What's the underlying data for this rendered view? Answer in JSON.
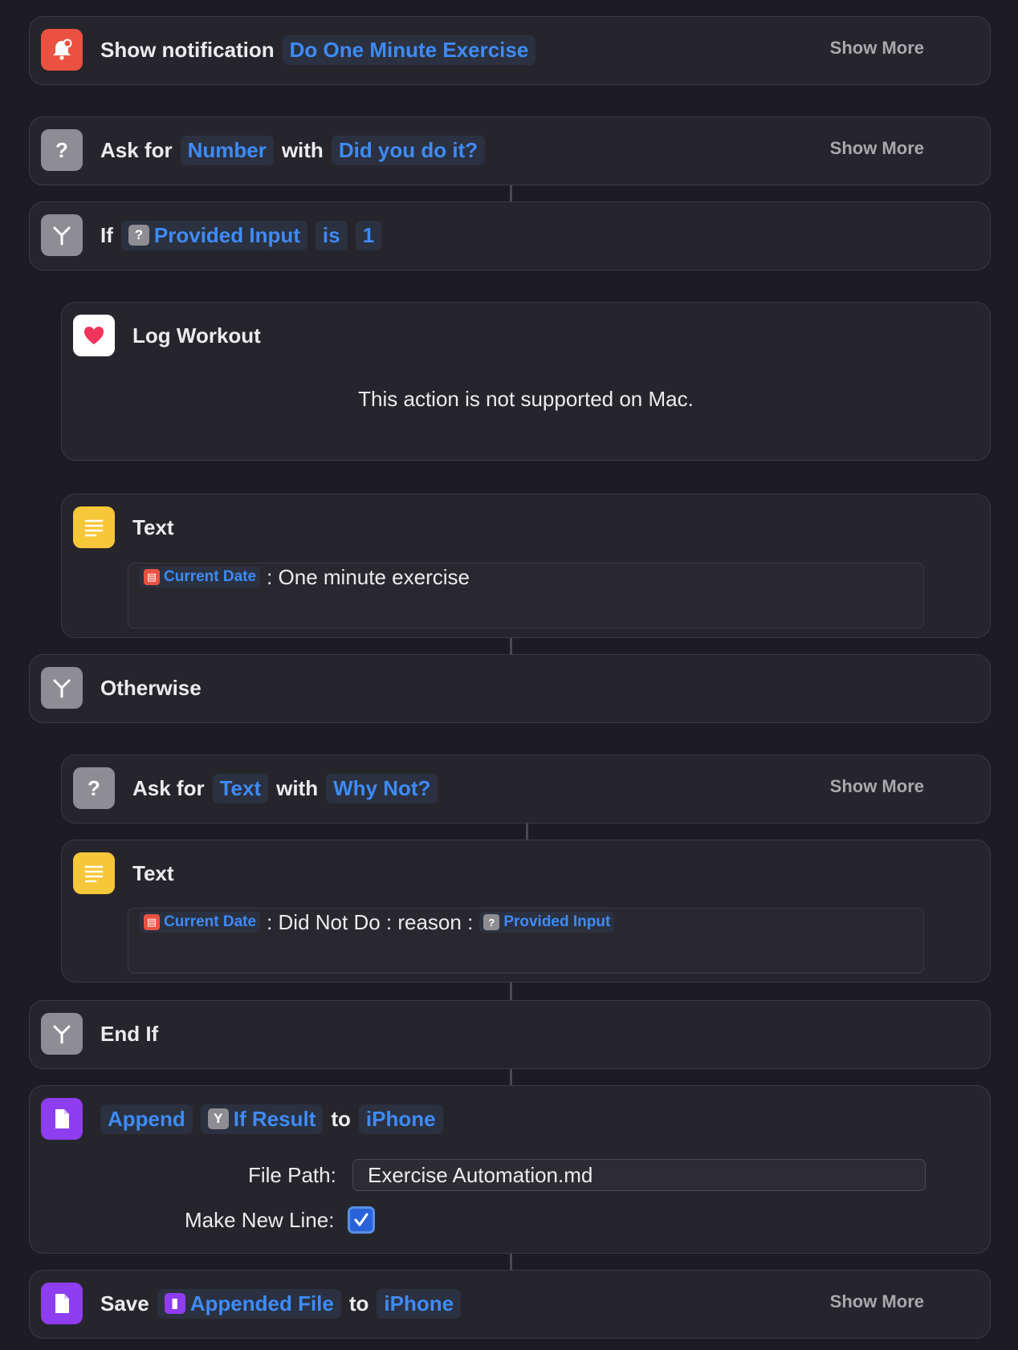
{
  "actions": {
    "notification": {
      "verb": "Show notification",
      "param": "Do One Minute Exercise",
      "show_more": "Show More"
    },
    "ask_number": {
      "verb": "Ask for",
      "type": "Number",
      "with": "with",
      "prompt": "Did you do it?",
      "show_more": "Show More"
    },
    "if_block": {
      "verb": "If",
      "input": "Provided Input",
      "op": "is",
      "value": "1"
    },
    "log_workout": {
      "title": "Log Workout",
      "message": "This action is not supported on Mac."
    },
    "text1": {
      "title": "Text",
      "token": "Current Date",
      "content": ": One minute exercise"
    },
    "otherwise": {
      "label": "Otherwise"
    },
    "ask_text": {
      "verb": "Ask for",
      "type": "Text",
      "with": "with",
      "prompt": "Why Not?",
      "show_more": "Show More"
    },
    "text2": {
      "title": "Text",
      "token": "Current Date",
      "content": ": Did Not Do : reason :",
      "token2": "Provided Input"
    },
    "end_if": {
      "label": "End If"
    },
    "append": {
      "verb": "Append",
      "token": "If Result",
      "to": "to",
      "target": "iPhone",
      "file_path_label": "File Path:",
      "file_path_value": "Exercise Automation.md",
      "new_line_label": "Make New Line:",
      "new_line_checked": true
    },
    "save": {
      "verb": "Save",
      "token": "Appended File",
      "to": "to",
      "target": "iPhone",
      "show_more": "Show More"
    }
  },
  "colors": {
    "accent": "#3f8bf6",
    "background": "#1e1c23",
    "card": "#27252c"
  }
}
